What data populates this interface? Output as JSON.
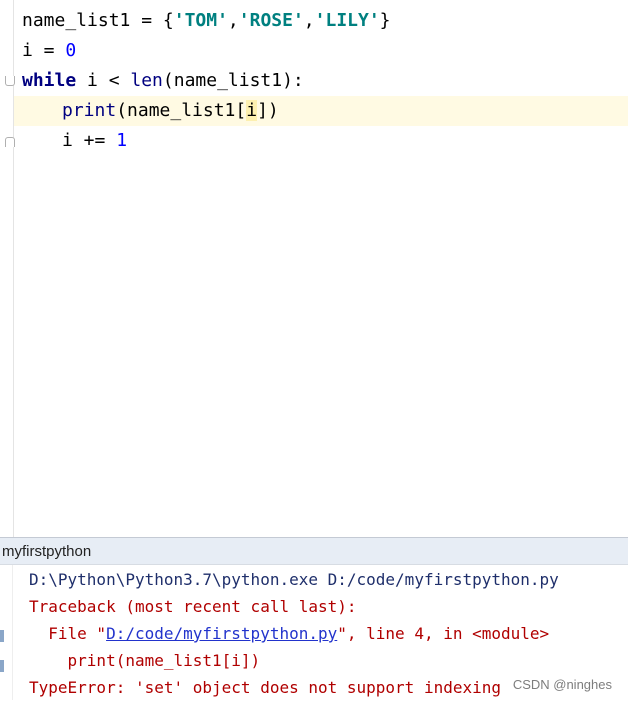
{
  "editor": {
    "lines": {
      "l1": {
        "var": "name_list1",
        "op": " = ",
        "open": "{",
        "s1": "'TOM'",
        "c1": ",",
        "s2": "'ROSE'",
        "c2": ",",
        "s3": "'LILY'",
        "close": "}"
      },
      "l2": {
        "var": "i",
        "op": " = ",
        "num": "0"
      },
      "l3": {
        "kw": "while",
        "mid": " i < ",
        "fn": "len",
        "args": "(name_list1):"
      },
      "l4": {
        "fn": "print",
        "pre": "(name_list1[",
        "idx": "i",
        "post": "])"
      },
      "l5": {
        "var": "i",
        "op": " += ",
        "num": "1"
      }
    }
  },
  "run_panel": {
    "title": "myfirstpython",
    "output": {
      "cmd": "D:\\Python\\Python3.7\\python.exe D:/code/myfirstpython.py",
      "traceback": "Traceback (most recent call last):",
      "file_prefix": "  File \"",
      "file_link": "D:/code/myfirstpython.py",
      "file_suffix": "\", line 4, in <module>",
      "code": "    print(name_list1[i])",
      "error": "TypeError: 'set' object does not support indexing"
    }
  },
  "watermark": "CSDN @ninghes",
  "colors": {
    "keyword": "#000080",
    "string": "#008080",
    "number": "#0000ff",
    "error_text": "#b00000",
    "link": "#2233cc",
    "current_line": "#fffae3"
  }
}
